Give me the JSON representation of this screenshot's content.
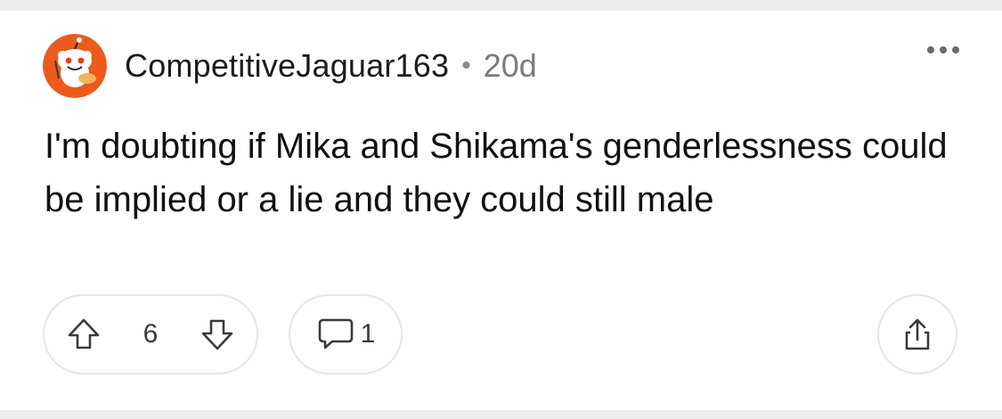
{
  "post": {
    "author": "CompetitiveJaguar163",
    "separator": "•",
    "age": "20d",
    "body": "I'm doubting if Mika and Shikama's genderlessness could be implied or a lie and they could still male"
  },
  "actions": {
    "vote_count": "6",
    "comment_count": "1"
  },
  "icons": {
    "avatar": "snoo-avatar-icon",
    "more": "more-options-icon",
    "upvote": "upvote-arrow-icon",
    "downvote": "downvote-arrow-icon",
    "comment": "comment-bubble-icon",
    "share": "share-icon"
  },
  "colors": {
    "avatar_bg": "#ee5a1b",
    "text": "#111111",
    "muted": "#7c7c7c",
    "border": "#e6e6e6",
    "band": "#ececec"
  }
}
